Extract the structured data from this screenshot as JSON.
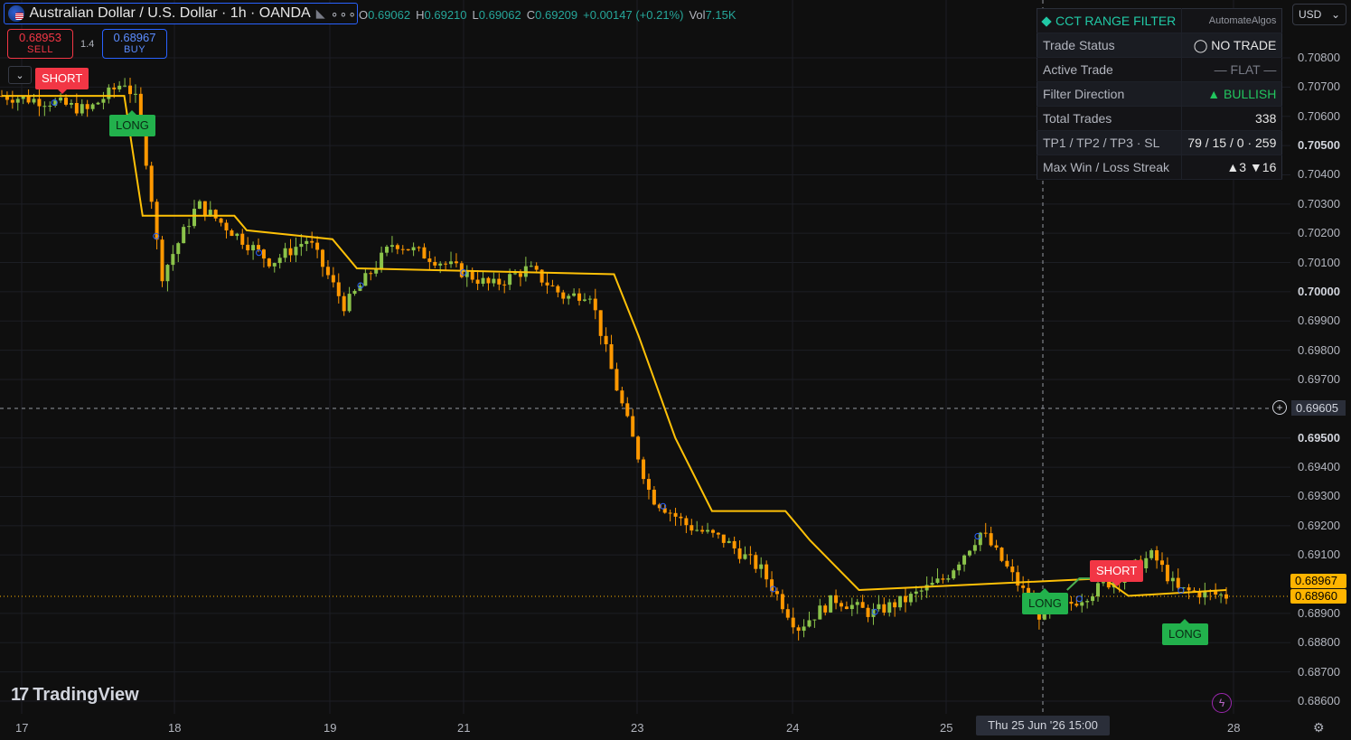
{
  "header": {
    "symbol": "Australian Dollar / U.S. Dollar · 1h · OANDA",
    "ohlc": {
      "o_label": "O",
      "o": "0.69062",
      "h_label": "H",
      "h": "0.69210",
      "l_label": "L",
      "l": "0.69062",
      "c_label": "C",
      "c": "0.69209",
      "change": "+0.00147 (+0.21%)",
      "vol_label": "Vol",
      "vol": "7.15K"
    }
  },
  "trade_panel": {
    "sell_price": "0.68953",
    "sell_label": "SELL",
    "spread": "1.4",
    "buy_price": "0.68967",
    "buy_label": "BUY"
  },
  "signals": {
    "short_1": "SHORT",
    "long_1": "LONG",
    "long_2": "LONG",
    "short_2": "SHORT",
    "long_3": "LONG"
  },
  "info_table": {
    "title": "CCT RANGE FILTER",
    "brand": "AutomateAlgos",
    "rows": [
      {
        "label": "Trade Status",
        "value": "◯ NO TRADE"
      },
      {
        "label": "Active Trade",
        "value": "— FLAT —"
      },
      {
        "label": "Filter Direction",
        "value": "▲ BULLISH"
      },
      {
        "label": "Total Trades",
        "value": "338"
      },
      {
        "label": "TP1 / TP2 / TP3 · SL",
        "value": "79 / 15 / 0 · 259"
      },
      {
        "label": "Max Win / Loss Streak",
        "value": "▲3  ▼16"
      }
    ]
  },
  "price_axis": {
    "currency": "USD",
    "labels": [
      "0.70800",
      "0.70700",
      "0.70600",
      "0.70500",
      "0.70400",
      "0.70300",
      "0.70200",
      "0.70100",
      "0.70000",
      "0.69900",
      "0.69800",
      "0.69700",
      "0.69500",
      "0.69400",
      "0.69300",
      "0.69200",
      "0.69100",
      "0.68900",
      "0.68800",
      "0.68700",
      "0.68600"
    ],
    "crosshair_price": "0.69605",
    "buy_tag": "0.68967",
    "last_tag": "0.68960"
  },
  "time_axis": {
    "labels": [
      "17",
      "18",
      "19",
      "21",
      "23",
      "24",
      "25",
      "28"
    ],
    "crosshair_time": "Thu 25 Jun '26   15:00"
  },
  "watermark": "TradingView",
  "colors": {
    "bull": "#8bc34a",
    "bear": "#ff9800",
    "filter_line": "#ffc107",
    "filter_line_bull": "#4caf50",
    "short_bg": "#f23645",
    "long_bg": "#22b14c",
    "accent": "#21c9a6"
  },
  "chart_data": {
    "type": "candlestick",
    "interval": "1h",
    "ylim": [
      0.6855,
      0.7088
    ],
    "close_path": [
      {
        "x": 0,
        "y": 0.7067
      },
      {
        "x": 0.04,
        "y": 0.7065
      },
      {
        "x": 0.07,
        "y": 0.7062
      },
      {
        "x": 0.1,
        "y": 0.7072
      },
      {
        "x": 0.11,
        "y": 0.7065
      },
      {
        "x": 0.12,
        "y": 0.704
      },
      {
        "x": 0.13,
        "y": 0.7005
      },
      {
        "x": 0.16,
        "y": 0.703
      },
      {
        "x": 0.19,
        "y": 0.702
      },
      {
        "x": 0.22,
        "y": 0.701
      },
      {
        "x": 0.25,
        "y": 0.7018
      },
      {
        "x": 0.28,
        "y": 0.6995
      },
      {
        "x": 0.32,
        "y": 0.7017
      },
      {
        "x": 0.36,
        "y": 0.701
      },
      {
        "x": 0.4,
        "y": 0.7002
      },
      {
        "x": 0.43,
        "y": 0.7008
      },
      {
        "x": 0.46,
        "y": 0.6998
      },
      {
        "x": 0.48,
        "y": 0.7
      },
      {
        "x": 0.5,
        "y": 0.697
      },
      {
        "x": 0.53,
        "y": 0.693
      },
      {
        "x": 0.56,
        "y": 0.692
      },
      {
        "x": 0.59,
        "y": 0.6915
      },
      {
        "x": 0.62,
        "y": 0.6905
      },
      {
        "x": 0.65,
        "y": 0.6885
      },
      {
        "x": 0.68,
        "y": 0.6895
      },
      {
        "x": 0.71,
        "y": 0.689
      },
      {
        "x": 0.74,
        "y": 0.6895
      },
      {
        "x": 0.77,
        "y": 0.6902
      },
      {
        "x": 0.8,
        "y": 0.6918
      },
      {
        "x": 0.83,
        "y": 0.69
      },
      {
        "x": 0.85,
        "y": 0.6888
      },
      {
        "x": 0.88,
        "y": 0.6895
      },
      {
        "x": 0.91,
        "y": 0.6902
      },
      {
        "x": 0.94,
        "y": 0.691
      },
      {
        "x": 0.96,
        "y": 0.6898
      },
      {
        "x": 1.0,
        "y": 0.6896
      }
    ],
    "filter_path": [
      {
        "x": 0,
        "y": 0.7067
      },
      {
        "x": 0.1,
        "y": 0.7067
      },
      {
        "x": 0.115,
        "y": 0.7026
      },
      {
        "x": 0.19,
        "y": 0.7026
      },
      {
        "x": 0.2,
        "y": 0.7021
      },
      {
        "x": 0.27,
        "y": 0.7018
      },
      {
        "x": 0.29,
        "y": 0.7008
      },
      {
        "x": 0.5,
        "y": 0.7006
      },
      {
        "x": 0.52,
        "y": 0.6985
      },
      {
        "x": 0.55,
        "y": 0.695
      },
      {
        "x": 0.58,
        "y": 0.6925
      },
      {
        "x": 0.64,
        "y": 0.6925
      },
      {
        "x": 0.66,
        "y": 0.6915
      },
      {
        "x": 0.7,
        "y": 0.6898
      },
      {
        "x": 0.87,
        "y": 0.6898
      },
      {
        "x": 0.88,
        "y": 0.6902
      },
      {
        "x": 0.9,
        "y": 0.6902
      },
      {
        "x": 0.92,
        "y": 0.6896
      },
      {
        "x": 1.0,
        "y": 0.6898
      }
    ]
  }
}
